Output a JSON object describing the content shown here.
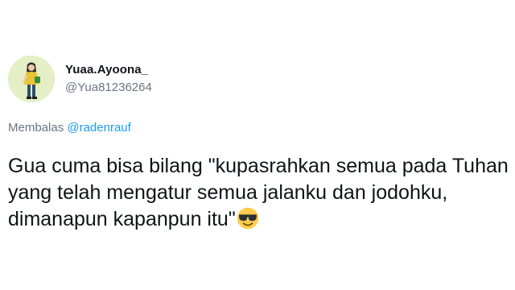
{
  "user": {
    "display_name": "Yuaa.Ayoona_",
    "handle": "@Yua81236264",
    "avatar": "avatar-illustration-girl"
  },
  "reply": {
    "prefix": "Membalas ",
    "mention": "@radenrauf"
  },
  "tweet": {
    "lines": [
      "Gua cuma bisa bilang \"kupasrahkan semua pada Tuhan",
      "yang telah mengatur semua jalanku dan jodohku,",
      "dimanapun kapanpun itu\""
    ],
    "emoji": "smiling-face-with-sunglasses-icon"
  },
  "colors": {
    "mention": "#1d9bf0",
    "secondary_text": "#6b7682",
    "primary_text": "#0f1419"
  }
}
